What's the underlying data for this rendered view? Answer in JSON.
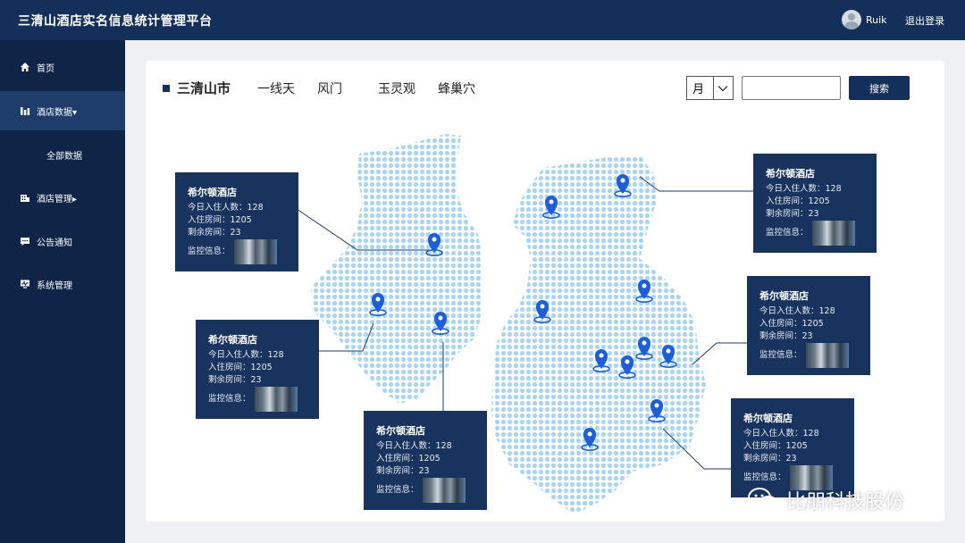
{
  "header": {
    "title": "三清山酒店实名信息统计管理平台",
    "user_name": "Ruik",
    "logout_label": "退出登录"
  },
  "sidebar": {
    "items": [
      {
        "label": "首页",
        "icon": "home-icon"
      },
      {
        "label": "酒店数据▾",
        "icon": "bar-chart-icon"
      },
      {
        "label": "全部数据"
      },
      {
        "label": "酒店管理▸",
        "icon": "hotel-icon"
      },
      {
        "label": "公告通知",
        "icon": "message-icon"
      },
      {
        "label": "系统管理",
        "icon": "monitor-icon"
      }
    ],
    "active_color": "#1f3d6b"
  },
  "tabs": {
    "main": "三清山市",
    "items": [
      "一线天",
      "风门",
      "玉灵观",
      "蜂巢穴"
    ]
  },
  "filter": {
    "period_value": "月",
    "search_placeholder": "",
    "search_label": "搜索"
  },
  "cards": [
    {
      "name": "希尔顿酒店",
      "checkins": "今日入住人数：128",
      "rooms_occupied": "入住房间：1205",
      "rooms_left": "剩余房间：23",
      "monitor": "监控信息："
    },
    {
      "name": "希尔顿酒店",
      "checkins": "今日入住人数：128",
      "rooms_occupied": "入住房间：1205",
      "rooms_left": "剩余房间：23",
      "monitor": "监控信息："
    },
    {
      "name": "希尔顿酒店",
      "checkins": "今日入住人数：128",
      "rooms_occupied": "入住房间：1205",
      "rooms_left": "剩余房间：23",
      "monitor": "监控信息："
    },
    {
      "name": "希尔顿酒店",
      "checkins": "今日入住人数：128",
      "rooms_occupied": "入住房间：1205",
      "rooms_left": "剩余房间：23",
      "monitor": "监控信息："
    },
    {
      "name": "希尔顿酒店",
      "checkins": "今日入住人数：128",
      "rooms_occupied": "入住房间：1205",
      "rooms_left": "剩余房间：23",
      "monitor": "监控信息："
    },
    {
      "name": "希尔顿酒店",
      "checkins": "今日入住人数：128",
      "rooms_occupied": "入住房间：1205",
      "rooms_left": "剩余房间：23",
      "monitor": "监控信息："
    }
  ],
  "watermark": {
    "text": "比朋科技股份"
  },
  "colors": {
    "header_bg": "#14305a",
    "sidebar_bg": "#0f2548",
    "card_bg": "#17335e",
    "map_dot": "#a9d5f5",
    "pin": "#1e5fd8"
  }
}
